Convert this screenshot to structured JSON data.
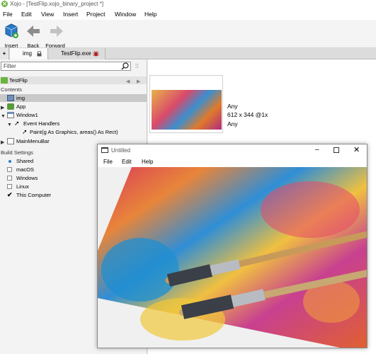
{
  "app": {
    "title": "Xojo - [TestFlip.xojo_binary_project *]"
  },
  "menu": [
    "File",
    "Edit",
    "View",
    "Insert",
    "Project",
    "Window",
    "Help"
  ],
  "toolbar": {
    "insert": "Insert",
    "back": "Back",
    "forward": "Forward"
  },
  "tabs": {
    "add": "+",
    "img": "img",
    "exe": "TestFlip.exe"
  },
  "navigator": {
    "filter_placeholder": "Filter",
    "project": "TestFlip",
    "contents_header": "Contents",
    "items": {
      "img": "img",
      "app": "App",
      "window1": "Window1",
      "event_handlers": "Event Handlers",
      "paint": "Paint(g As Graphics, areas() As Rect)",
      "menubar": "MainMenuBar"
    },
    "build_header": "Build Settings",
    "builds": [
      {
        "label": "Shared",
        "state": "selected"
      },
      {
        "label": "macOS",
        "state": "unchecked"
      },
      {
        "label": "Windows",
        "state": "unchecked"
      },
      {
        "label": "Linux",
        "state": "unchecked"
      },
      {
        "label": "This Computer",
        "state": "checked"
      }
    ]
  },
  "image_info": {
    "line1": "Any",
    "line2": "612 x 344 @1x",
    "line3": "Any"
  },
  "window": {
    "title": "Untitled",
    "menu": [
      "File",
      "Edit",
      "Help"
    ]
  }
}
